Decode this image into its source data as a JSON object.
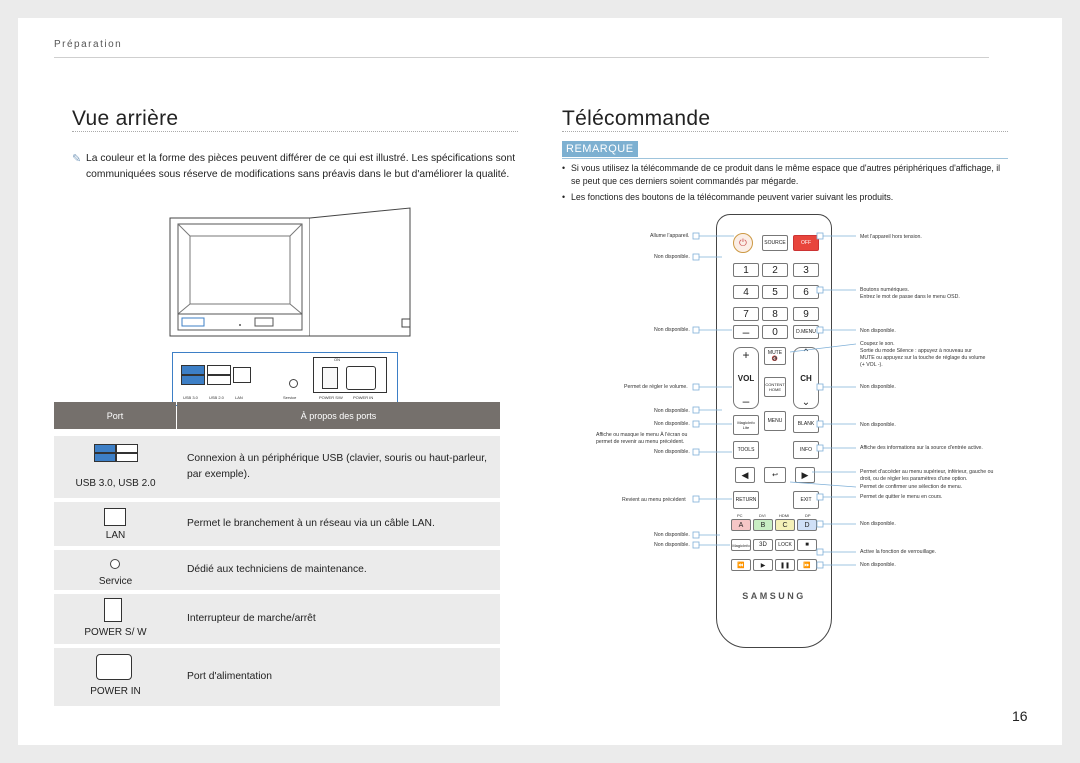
{
  "header": {
    "section": "Préparation",
    "page_number": "16"
  },
  "rear": {
    "title": "Vue arrière",
    "note": "La couleur et la forme des pièces peuvent différer de ce qui est illustré. Les spécifications sont communiquées sous réserve de modifications sans préavis dans le but d'améliorer la qualité.",
    "panel_labels": [
      "USB 3.0",
      "USB 2.0",
      "LAN",
      "Service",
      "POWER S/W",
      "POWER IN"
    ],
    "switch_label": "ON"
  },
  "ports": {
    "col_port": "Port",
    "col_about": "À propos des ports",
    "rows": [
      {
        "name": "USB 3.0, USB 2.0",
        "desc": "Connexion à un périphérique USB (clavier, souris ou haut-parleur, par exemple)."
      },
      {
        "name": "LAN",
        "desc": "Permet le branchement à un réseau via un câble LAN."
      },
      {
        "name": "Service",
        "desc": "Dédié aux techniciens de maintenance."
      },
      {
        "name": "POWER S/ W",
        "desc": "Interrupteur de marche/arrêt"
      },
      {
        "name": "POWER IN",
        "desc": "Port d'alimentation"
      }
    ]
  },
  "remote": {
    "title": "Télécommande",
    "remark": "REMARQUE",
    "bullets": [
      "Si vous utilisez la télécommande de ce produit dans le même espace que d'autres périphériques d'affichage, il se peut que ces derniers soient commandés par mégarde.",
      "Les fonctions des boutons de la télécommande peuvent varier suivant les produits."
    ],
    "left_labels": [
      "Allume l'appareil.",
      "Non disponible.",
      "Non disponible.",
      "Permet de régler le volume.",
      "Non disponible.",
      "Non disponible.",
      "Affiche ou masque le menu À l'écran ou permet de revenir au menu précédent.",
      "Non disponible.",
      "Revient au menu précédent",
      "Non disponible.",
      "Non disponible."
    ],
    "right_labels": [
      "Met l'appareil hors tension.",
      "Boutons numériques.",
      "Entrez le mot de passe dans le menu OSD.",
      "Non disponible.",
      "Coupez le son.",
      "Sortie du mode Silence : appuyez à nouveau sur MUTE ou appuyez sur la touche de réglage du volume (+ VOL -).",
      "Non disponible.",
      "Non disponible.",
      "Affiche des informations sur la source d'entrée active.",
      "Permet d'accéder au menu supérieur, inférieur, gauche ou droit, ou de régler les paramètres d'une option.",
      "Permet de confirmer une sélection de menu.",
      "Permet de quitter le menu en cours.",
      "Non disponible.",
      "Active la fonction de verrouillage.",
      "Non disponible."
    ],
    "buttons": {
      "source": "SOURCE",
      "off": "OFF",
      "nums": [
        "1",
        "2",
        "3",
        "4",
        "5",
        "6",
        "7",
        "8",
        "9",
        "0"
      ],
      "dmenu": "D.MENU",
      "mute": "MUTE",
      "vol": "VOL",
      "ch": "CH",
      "content": "CONTENT\nHOME",
      "magicinfo": "MagicInfo\nLite",
      "menu": "MENU",
      "blank": "BLANK",
      "tools": "TOOLS",
      "info": "INFO",
      "return": "RETURN",
      "exit": "EXIT",
      "abcd": [
        "A",
        "B",
        "C",
        "D"
      ],
      "pc": "PC",
      "dvi": "DVI",
      "hdmi": "HDMI",
      "dp": "DP",
      "magic": "MagicInfo",
      "threed": "3D",
      "lock": "LOCK",
      "brand": "SAMSUNG"
    }
  },
  "colors": {
    "remark_bg": "#7db0d1",
    "table_header": "#75706c",
    "row_bg": "#ebebeb",
    "power_red": "#e8453c"
  }
}
